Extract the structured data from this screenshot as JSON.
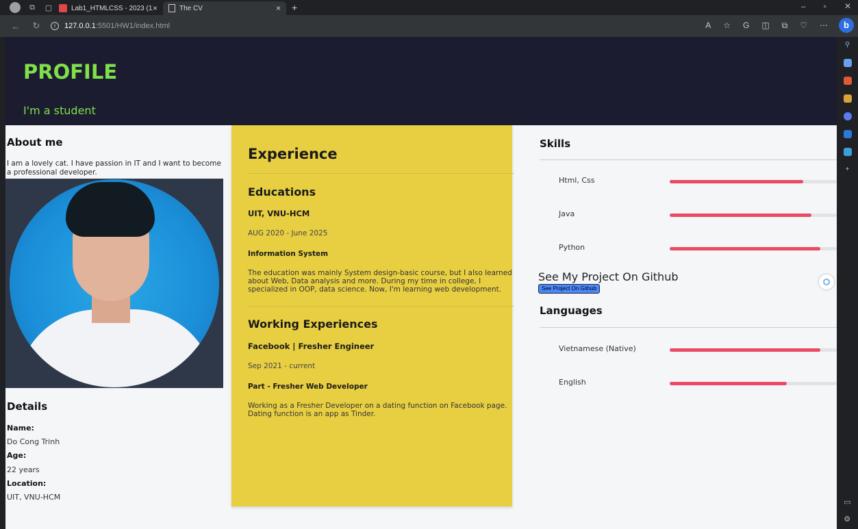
{
  "browser": {
    "tabs": [
      {
        "label": "Lab1_HTMLCSS - 2023 (1).pdf",
        "active": false
      },
      {
        "label": "The CV",
        "active": true
      }
    ],
    "url_host": "127.0.0.1",
    "url_path": ":5501/HW1/index.html"
  },
  "header": {
    "title": "PROFILE",
    "subtitle": "I'm a student"
  },
  "about": {
    "title": "About me",
    "text": "I am a lovely cat. I have passion in IT and I want to become a professional developer."
  },
  "details": {
    "title": "Details",
    "name_label": "Name:",
    "name_value": "Do Cong Trinh",
    "age_label": "Age:",
    "age_value": "22 years",
    "location_label": "Location:",
    "location_value": "UIT, VNU-HCM"
  },
  "experience": {
    "title": "Experience",
    "education": {
      "heading": "Educations",
      "org": "UIT, VNU-HCM",
      "date": "AUG 2020 - June 2025",
      "role": "Information System",
      "desc": "The education was mainly System design-basic course, but I also learned about Web, Data analysis and more. During my time in college, I specialized in OOP, data science. Now, I'm learning web development."
    },
    "work": {
      "heading": "Working Experiences",
      "org": "Facebook | Fresher Engineer",
      "date": "Sep 2021 - current",
      "role": "Part - Fresher Web Developer",
      "desc": "Working as a Fresher Developer on a dating function on Facebook page. Dating function is an app as Tinder."
    }
  },
  "skills": {
    "title": "Skills",
    "items": [
      {
        "name": "Html, Css",
        "level": 0.8
      },
      {
        "name": "Java",
        "level": 0.85
      },
      {
        "name": "Python",
        "level": 0.9
      }
    ]
  },
  "github": {
    "title": "See My Project On Github",
    "button": "See Project On Github"
  },
  "languages": {
    "title": "Languages",
    "items": [
      {
        "name": "Vietnamese (Native)",
        "level": 0.9
      },
      {
        "name": "English",
        "level": 0.7
      }
    ]
  },
  "colors": {
    "header_bg": "#1c1c30",
    "header_text": "#7fe04a",
    "experience_bg": "#e8cf42",
    "bar_fill": "#ea4a64"
  }
}
